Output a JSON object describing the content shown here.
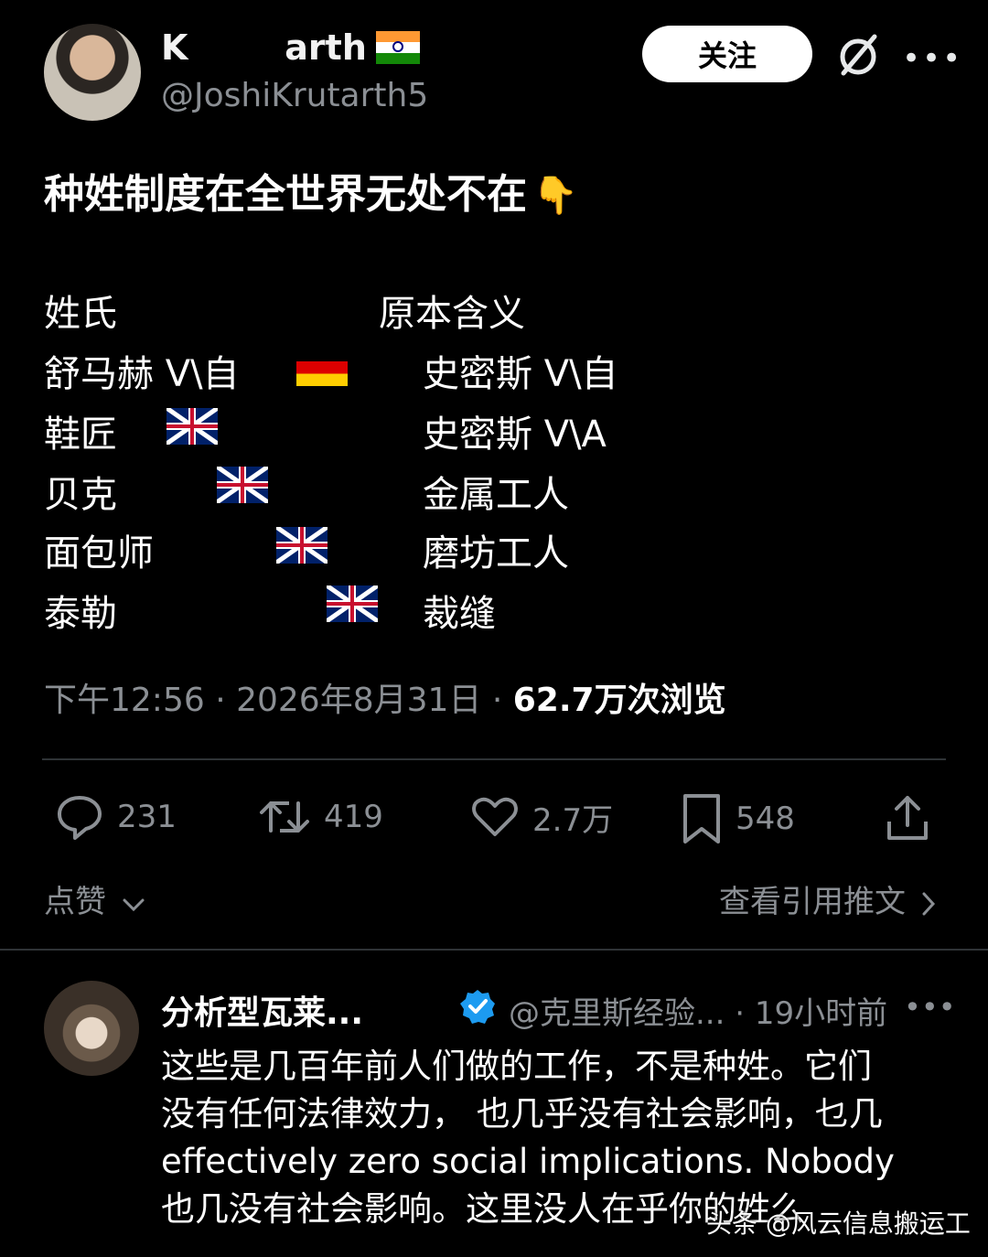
{
  "header": {
    "display_name": "K        arth",
    "handle": "@JoshiKrutarth5",
    "follow_label": "关注",
    "more_label": "•••"
  },
  "tweet": {
    "text": "种姓制度在全世界无处不在",
    "emoji": "👇",
    "col1_header": "姓氏",
    "col2_header": "原本含义",
    "rows": [
      {
        "surname": "舒马赫 ᐯ\\自",
        "flag": "germany",
        "meaning": "史密斯 ᐯ\\自"
      },
      {
        "surname": "鞋匠",
        "flag": "uk",
        "meaning": "史密斯 ᐯ\\A"
      },
      {
        "surname": "贝克",
        "flag": "uk",
        "meaning": "金属工人"
      },
      {
        "surname": "面包师",
        "flag": "uk",
        "meaning": "磨坊工人"
      },
      {
        "surname": "泰勒",
        "flag": "uk",
        "meaning": "裁缝"
      }
    ],
    "time": "下午12:56 · 2026年8月31日 · ",
    "views": "62.7万次浏览"
  },
  "actions": {
    "replies": "231",
    "retweets": "419",
    "likes": "2.7万",
    "bookmarks": "548"
  },
  "footer": {
    "likes_label": "点赞",
    "quotes_label": "查看引用推文"
  },
  "reply": {
    "name": "分析型瓦莱...",
    "handle_time": "@克里斯经验... · 19小时前",
    "more_label": "•••",
    "lines": [
      "这些是几百年前人们做的工作，不是种姓。它们",
      "没有任何法律效力， 也几乎没有社会影响，乜几",
      "effectively zero social implications. Nobody",
      "也几没有社会影响。这里没人在乎你的姓么"
    ]
  },
  "watermark": "头条 @风云信息搬运工",
  "colors": {
    "background": "#000000",
    "muted": "#8b8f94",
    "verified": "#1d9bf0"
  }
}
